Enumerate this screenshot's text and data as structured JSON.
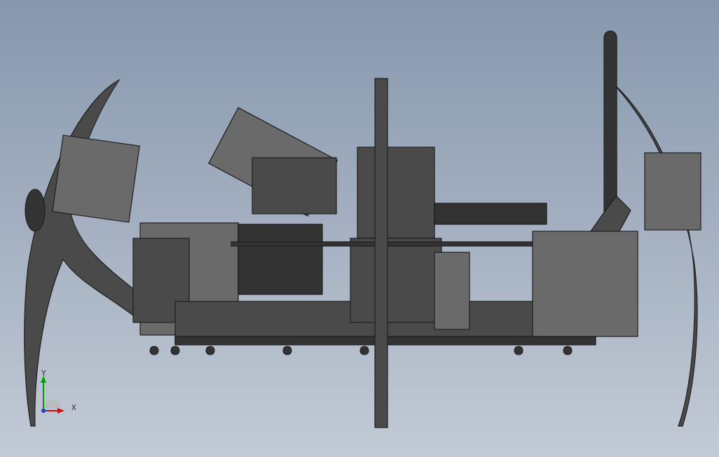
{
  "viewport": {
    "triad": {
      "axes": [
        {
          "kind": "vertical",
          "label": "Y",
          "color": "#00a000"
        },
        {
          "kind": "horizontal",
          "label": "X",
          "color": "#d01010"
        }
      ]
    }
  }
}
